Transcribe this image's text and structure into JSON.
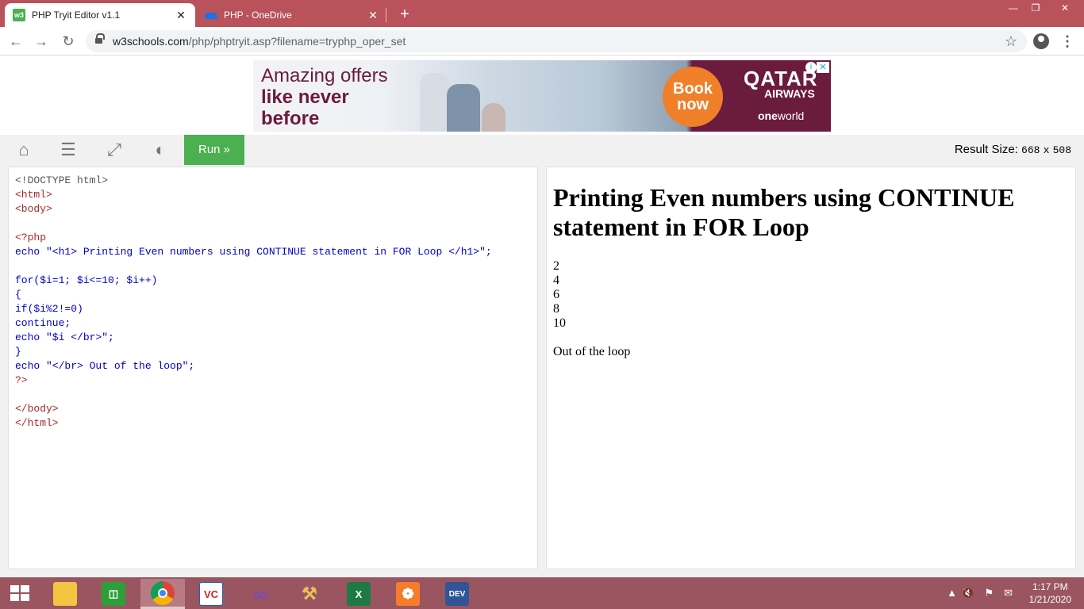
{
  "browser": {
    "tabs": [
      {
        "title": "PHP Tryit Editor v1.1",
        "active": true,
        "favicon": "w3"
      },
      {
        "title": "PHP - OneDrive",
        "active": false,
        "favicon": "onedrive-icon"
      }
    ],
    "new_tab_label": "+",
    "close_glyph": "✕",
    "url_host": "w3schools.com",
    "url_path": "/php/phptryit.asp?filename=tryphp_oper_set"
  },
  "ad": {
    "line1": "Amazing offers",
    "line2": "like never",
    "line3": "before",
    "cta_line1": "Book",
    "cta_line2": "now",
    "brand": "QATAR",
    "brand_sub": "AIRWAYS",
    "alliance_bold": "one",
    "alliance_rest": "world",
    "colors": {
      "brand": "#6b1b3e",
      "cta": "#f07f2a"
    }
  },
  "tryit": {
    "run_label": "Run »",
    "result_size_label": "Result Size:",
    "result_width": "668",
    "result_x": "x",
    "result_height": "508",
    "accent": "#4caf50"
  },
  "code": {
    "lines": [
      "<!DOCTYPE html>",
      "<html>",
      "<body>",
      "",
      "<?php",
      "echo \"<h1> Printing Even numbers using CONTINUE statement in FOR Loop </h1>\";",
      "",
      "for($i=1; $i<=10; $i++)",
      "{",
      "if($i%2!=0)",
      "continue;",
      "echo \"$i </br>\";",
      "}",
      "echo \"</br> Out of the loop\";",
      "?>",
      "",
      "</body>",
      "</html>"
    ]
  },
  "result": {
    "heading": "Printing Even numbers using CONTINUE statement in FOR Loop",
    "numbers": [
      "2",
      "4",
      "6",
      "8",
      "10"
    ],
    "footer": "Out of the loop"
  },
  "taskbar": {
    "apps": [
      {
        "name": "file-explorer",
        "label": "",
        "color": "#f4c542"
      },
      {
        "name": "microsoft-store",
        "label": "",
        "color": "#2e9e3a"
      },
      {
        "name": "chrome",
        "label": "",
        "color": "#ffffff"
      },
      {
        "name": "vs-code-c",
        "label": "VC",
        "color": "#ffffff"
      },
      {
        "name": "visual-studio",
        "label": "",
        "color": "#7e4bb5"
      },
      {
        "name": "tools",
        "label": "",
        "color": "#e8c15a"
      },
      {
        "name": "excel",
        "label": "X",
        "color": "#1d7a45"
      },
      {
        "name": "xampp",
        "label": "",
        "color": "#f57c2a"
      },
      {
        "name": "dev-cpp",
        "label": "DEV",
        "color": "#2f5597"
      }
    ],
    "time": "1:17 PM",
    "date": "1/21/2020"
  }
}
